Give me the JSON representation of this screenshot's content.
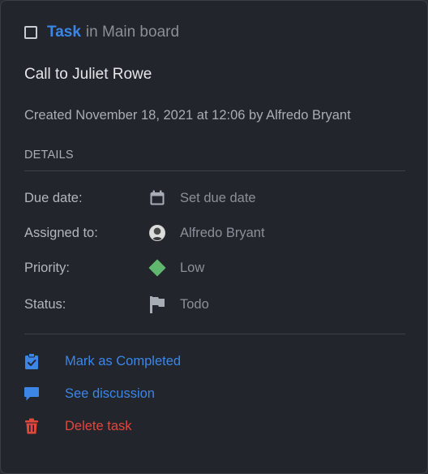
{
  "header": {
    "type_label": "Task",
    "board_text": "in Main board"
  },
  "task": {
    "title": "Call to Juliet Rowe",
    "created_text": "Created November 18, 2021 at 12:06 by Alfredo Bryant"
  },
  "details": {
    "section_title": "DETAILS",
    "due_date": {
      "label": "Due date:",
      "value": "Set due date",
      "icon": "calendar-icon"
    },
    "assigned_to": {
      "label": "Assigned to:",
      "value": "Alfredo Bryant",
      "icon": "avatar"
    },
    "priority": {
      "label": "Priority:",
      "value": "Low",
      "icon": "diamond-icon",
      "color": "#5fb86d"
    },
    "status": {
      "label": "Status:",
      "value": "Todo",
      "icon": "flag-icon"
    }
  },
  "actions": {
    "complete": {
      "label": "Mark as Completed",
      "icon": "clipboard-check-icon",
      "color": "#3c86e8"
    },
    "discussion": {
      "label": "See discussion",
      "icon": "chat-bubble-icon",
      "color": "#3c86e8"
    },
    "delete": {
      "label": "Delete task",
      "icon": "trash-icon",
      "color": "#e0473d"
    }
  },
  "colors": {
    "background": "#22252b",
    "accent": "#3c86e8",
    "danger": "#e0473d"
  }
}
